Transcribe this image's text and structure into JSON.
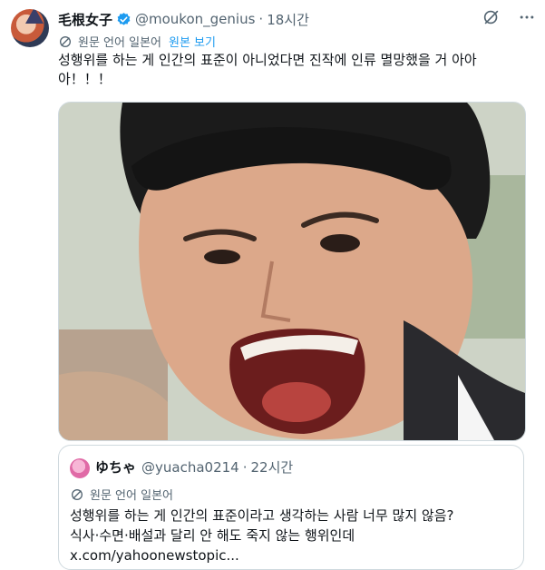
{
  "author": {
    "name": "毛根女子",
    "handle": "@moukon_genius",
    "separator": "·",
    "time": "18시간"
  },
  "translation": {
    "label": "원문 언어 일본어",
    "show_original": "원본 보기"
  },
  "tweet_text": "성행위를 하는 게 인간의 표준이 아니었다면 진작에 인류 멸망했을 거 아아아！！！",
  "quoted": {
    "name": "ゆちゃ",
    "handle": "@yuacha0214",
    "separator": "·",
    "time": "22시간",
    "translation_label": "원문 언어 일본어",
    "lines": [
      "성행위를 하는 게 인간의 표준이라고 생각하는 사람 너무 많지 않음?",
      "식사·수면·배설과 달리 안 해도 죽지 않는 행위인데",
      "x.com/yahoonewstopic..."
    ]
  },
  "colors": {
    "verified": "#1d9bf0",
    "link": "#1d9bf0",
    "secondary_text": "#536471"
  },
  "icons": {
    "verified": "verified-badge-icon",
    "grok": "grok-icon",
    "more": "more-icon",
    "translate": "translate-icon"
  }
}
